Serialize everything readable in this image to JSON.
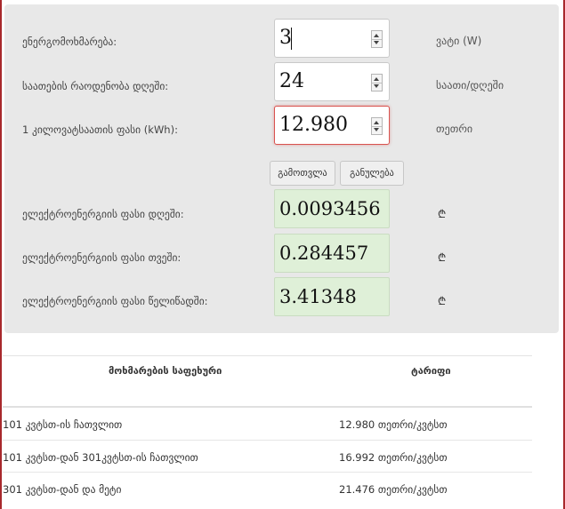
{
  "calculator": {
    "power": {
      "label": "ენერგომოხმარება:",
      "value": "3",
      "unit": "ვატი (W)"
    },
    "hours": {
      "label": "საათების რაოდენობა დღეში:",
      "value": "24",
      "unit": "საათი/დღეში"
    },
    "price": {
      "label": "1 კილოვატსაათის ფასი (kWh):",
      "value": "12.980",
      "unit": "თეთრი"
    },
    "calculate_label": "გამოთვლა",
    "clear_label": "განულება",
    "results": [
      {
        "label": "ელექტროენერგიის ფასი დღეში:",
        "value": "0.0093456",
        "currency": "₾"
      },
      {
        "label": "ელექტროენერგიის ფასი თვეში:",
        "value": "0.284457",
        "currency": "₾"
      },
      {
        "label": "ელექტროენერგიის ფასი წელიწადში:",
        "value": "3.41348",
        "currency": "₾"
      }
    ]
  },
  "tariff_table": {
    "headers": [
      "მოხმარების საფეხური",
      "ტარიფი"
    ],
    "rows": [
      [
        "101 კვტსთ-ის ჩათვლით",
        "12.980 თეთრი/კვტსთ"
      ],
      [
        "101 კვტსთ-დან 301კვტსთ-ის ჩათვლით",
        "16.992 თეთრი/კვტსთ"
      ],
      [
        "301 კვტსთ-დან და მეტი",
        "21.476 თეთრი/კვტსთ"
      ]
    ]
  },
  "colors": {
    "frame": "#a8282c",
    "panel": "#e8e8e8",
    "result_bg": "#dff0d8",
    "error_border": "#d9534f"
  }
}
